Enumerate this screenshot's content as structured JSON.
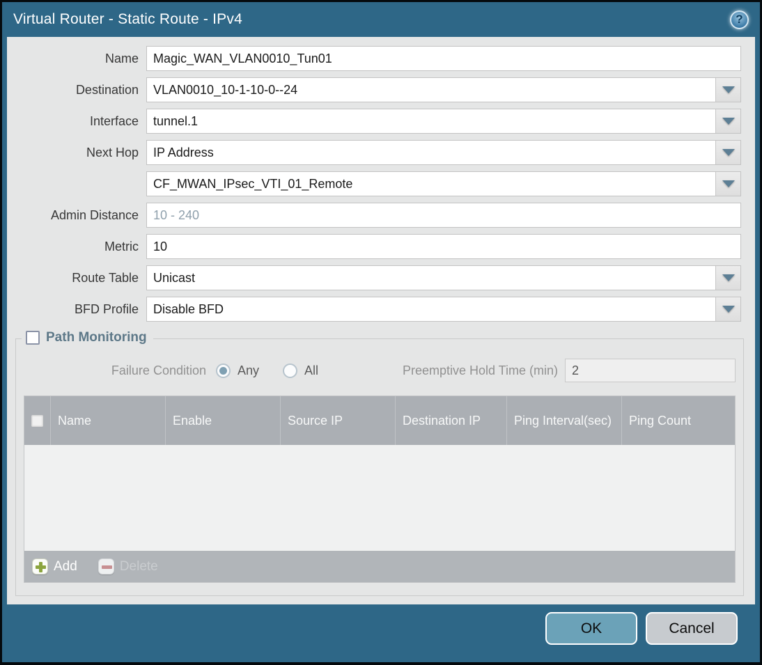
{
  "colors": {
    "frame_teal": "#2e6787",
    "outer_border": "#050a0d",
    "body_gray": "#e5e6e6",
    "table_header_gray": "#abafb4",
    "table_footer_gray": "#b1b5b9",
    "ok_button_blue": "#6ba2b8",
    "cancel_button_gray": "#c7cbcf",
    "dropdown_arrow": "#5d7f95",
    "add_icon_green": "#8ca53f",
    "delete_icon_red": "#c78f92"
  },
  "dialog": {
    "title": "Virtual Router - Static Route - IPv4"
  },
  "icons": {
    "help": "?"
  },
  "form": {
    "rows": [
      {
        "label": "Name",
        "value": "Magic_WAN_VLAN0010_Tun01"
      },
      {
        "label": "Destination",
        "value": "VLAN0010_10-1-10-0--24"
      },
      {
        "label": "Interface",
        "value": "tunnel.1"
      },
      {
        "label": "Next Hop",
        "value": "IP Address"
      },
      {
        "label": "",
        "value": "CF_MWAN_IPsec_VTI_01_Remote"
      },
      {
        "label": "Admin Distance",
        "value": "",
        "placeholder": "10 - 240"
      },
      {
        "label": "Metric",
        "value": "10"
      },
      {
        "label": "Route Table",
        "value": "Unicast"
      },
      {
        "label": "BFD Profile",
        "value": "Disable BFD"
      }
    ]
  },
  "path_monitoring": {
    "title": "Path Monitoring",
    "enabled": false,
    "failure_condition": {
      "label": "Failure Condition",
      "options": [
        "Any",
        "All"
      ],
      "selected": "Any"
    },
    "preemptive": {
      "label": "Preemptive Hold Time (min)",
      "value": "2"
    },
    "table": {
      "columns": [
        "Name",
        "Enable",
        "Source IP",
        "Destination IP",
        "Ping Interval(sec)",
        "Ping Count"
      ],
      "rows": []
    },
    "toolbar": {
      "add_label": "Add",
      "delete_label": "Delete"
    }
  },
  "footer": {
    "ok_label": "OK",
    "cancel_label": "Cancel"
  }
}
